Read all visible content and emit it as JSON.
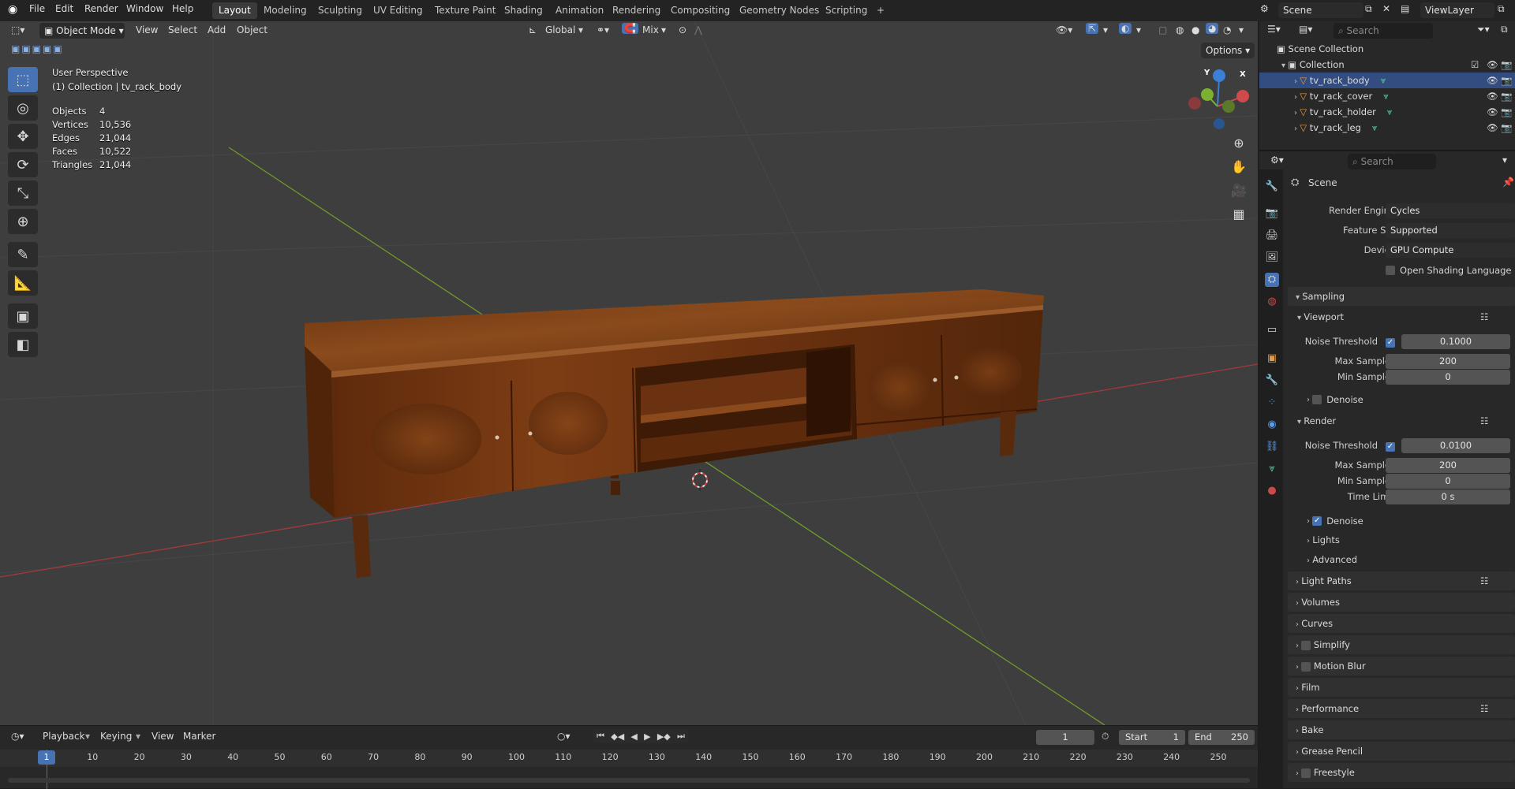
{
  "menu": [
    "File",
    "Edit",
    "Render",
    "Window",
    "Help"
  ],
  "workspaces": [
    "Layout",
    "Modeling",
    "Sculpting",
    "UV Editing",
    "Texture Paint",
    "Shading",
    "Animation",
    "Rendering",
    "Compositing",
    "Geometry Nodes",
    "Scripting",
    "+"
  ],
  "scene_name": "Scene",
  "view_layer": "ViewLayer",
  "viewport_header": {
    "mode": "Object Mode",
    "menus": [
      "View",
      "Select",
      "Add",
      "Object"
    ],
    "orientation": "Global",
    "snap": "Mix",
    "options": "Options"
  },
  "viewport_info": {
    "perspective": "User Perspective",
    "collection": "(1) Collection | tv_rack_body",
    "stats": [
      {
        "label": "Objects",
        "value": "4"
      },
      {
        "label": "Vertices",
        "value": "10,536"
      },
      {
        "label": "Edges",
        "value": "21,044"
      },
      {
        "label": "Faces",
        "value": "10,522"
      },
      {
        "label": "Triangles",
        "value": "21,044"
      }
    ]
  },
  "gizmo": {
    "x": "X",
    "y": "Y",
    "z": "Z"
  },
  "outliner": {
    "search_placeholder": "Search",
    "scene_collection": "Scene Collection",
    "collection": "Collection",
    "objects": [
      "tv_rack_body",
      "tv_rack_cover",
      "tv_rack_holder",
      "tv_rack_leg"
    ],
    "selected": "tv_rack_body"
  },
  "properties": {
    "search_placeholder": "Search",
    "context": "Scene",
    "render_engine_label": "Render Engine",
    "render_engine": "Cycles",
    "feature_set_label": "Feature Set",
    "feature_set": "Supported",
    "device_label": "Device",
    "device": "GPU Compute",
    "osl_label": "Open Shading Language",
    "sampling": "Sampling",
    "viewport": "Viewport",
    "noise_threshold_label": "Noise Threshold",
    "viewport_noise_threshold": "0.1000",
    "max_samples_label": "Max Samples",
    "viewport_max_samples": "200",
    "min_samples_label": "Min Samples",
    "viewport_min_samples": "0",
    "denoise_label": "Denoise",
    "render": "Render",
    "render_noise_threshold": "0.0100",
    "render_max_samples": "200",
    "render_min_samples": "0",
    "time_limit_label": "Time Limit",
    "time_limit": "0 s",
    "lights": "Lights",
    "advanced": "Advanced",
    "panels": [
      "Light Paths",
      "Volumes",
      "Curves",
      "Simplify",
      "Motion Blur",
      "Film",
      "Performance",
      "Bake",
      "Grease Pencil",
      "Freestyle"
    ]
  },
  "timeline": {
    "menus": [
      "Playback",
      "Keying",
      "View",
      "Marker"
    ],
    "current_frame": "1",
    "start_label": "Start",
    "start": "1",
    "end_label": "End",
    "end": "250",
    "ticks": [
      "1",
      "10",
      "20",
      "30",
      "40",
      "50",
      "60",
      "70",
      "80",
      "90",
      "100",
      "110",
      "120",
      "130",
      "140",
      "150",
      "160",
      "170",
      "180",
      "190",
      "200",
      "210",
      "220",
      "230",
      "240",
      "250"
    ]
  },
  "colors": {
    "accent": "#4772b3",
    "selection": "#334d80",
    "x_axis": "#d04a4a",
    "y_axis": "#7bb031",
    "z_axis": "#3c7fd6",
    "wood": "#7a3a14"
  }
}
